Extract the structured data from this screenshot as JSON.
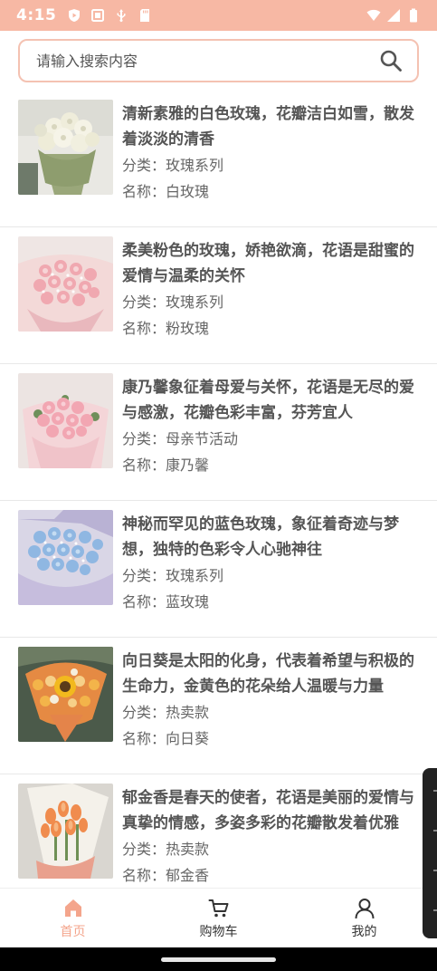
{
  "status_bar": {
    "time": "4:15",
    "left_icons": [
      "play-shield-icon",
      "screen-icon",
      "usb-icon",
      "sd-card-icon"
    ],
    "right_icons": [
      "wifi-icon",
      "signal-icon",
      "battery-icon"
    ]
  },
  "search": {
    "placeholder": "请输入搜索内容"
  },
  "products": [
    {
      "title": "清新素雅的白色玫瑰，花瓣洁白如雪，散发着淡淡的清香",
      "category_label": "分类：",
      "category": "玫瑰系列",
      "name_label": "名称：",
      "name": "白玫瑰",
      "image": "white-rose-bouquet"
    },
    {
      "title": "柔美粉色的玫瑰，娇艳欲滴，花语是甜蜜的爱情与温柔的关怀",
      "category_label": "分类：",
      "category": "玫瑰系列",
      "name_label": "名称：",
      "name": "粉玫瑰",
      "image": "pink-rose-bouquet"
    },
    {
      "title": "康乃馨象征着母爱与关怀，花语是无尽的爱与感激，花瓣色彩丰富，芬芳宜人",
      "category_label": "分类：",
      "category": "母亲节活动",
      "name_label": "名称：",
      "name": "康乃馨",
      "image": "carnation-bouquet"
    },
    {
      "title": "神秘而罕见的蓝色玫瑰，象征着奇迹与梦想，独特的色彩令人心驰神往",
      "category_label": "分类：",
      "category": "玫瑰系列",
      "name_label": "名称：",
      "name": "蓝玫瑰",
      "image": "blue-rose-bouquet"
    },
    {
      "title": "向日葵是太阳的化身，代表着希望与积极的生命力，金黄色的花朵给人温暖与力量",
      "category_label": "分类：",
      "category": "热卖款",
      "name_label": "名称：",
      "name": "向日葵",
      "image": "sunflower-bouquet"
    },
    {
      "title": "郁金香是春天的使者，花语是美丽的爱情与真挚的情感，多姿多彩的花瓣散发着优雅",
      "category_label": "分类：",
      "category": "热卖款",
      "name_label": "名称：",
      "name": "郁金香",
      "image": "tulip-bouquet"
    }
  ],
  "bottom_nav": [
    {
      "label": "首页",
      "icon": "home-icon",
      "active": true
    },
    {
      "label": "购物车",
      "icon": "cart-icon",
      "active": false
    },
    {
      "label": "我的",
      "icon": "user-icon",
      "active": false
    }
  ],
  "colors": {
    "accent": "#f4a58c",
    "status_bar": "#f7b8a4",
    "search_border": "#f4c2b2",
    "title_text": "#555555"
  }
}
